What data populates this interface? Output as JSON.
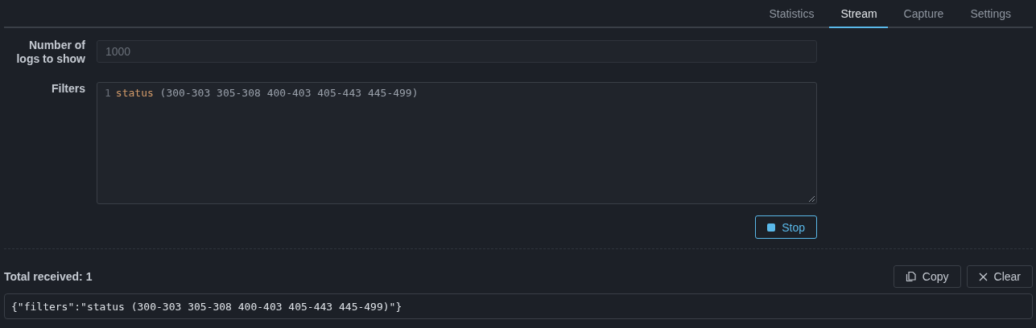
{
  "tabs": [
    {
      "label": "Statistics",
      "selected": false
    },
    {
      "label": "Stream",
      "selected": true
    },
    {
      "label": "Capture",
      "selected": false
    },
    {
      "label": "Settings",
      "selected": false
    }
  ],
  "form": {
    "logs_label": "Number of logs to show",
    "logs_field": {
      "placeholder": "1000"
    },
    "filters_label": "Filters",
    "filters_editor": {
      "lines": [
        {
          "number": "1",
          "tokens": [
            {
              "kind": "keyword",
              "text": "status"
            },
            {
              "kind": "plain",
              "text": " (300-303 305-308 400-403 405-443 445-499)"
            }
          ]
        }
      ]
    },
    "stop_button": "Stop"
  },
  "results": {
    "total": "Total received: 1",
    "copy_button": "Copy",
    "clear_button": "Clear",
    "entries": [
      "{\"filters\":\"status (300-303 305-308 400-403 405-443 445-499)\"}"
    ]
  }
}
